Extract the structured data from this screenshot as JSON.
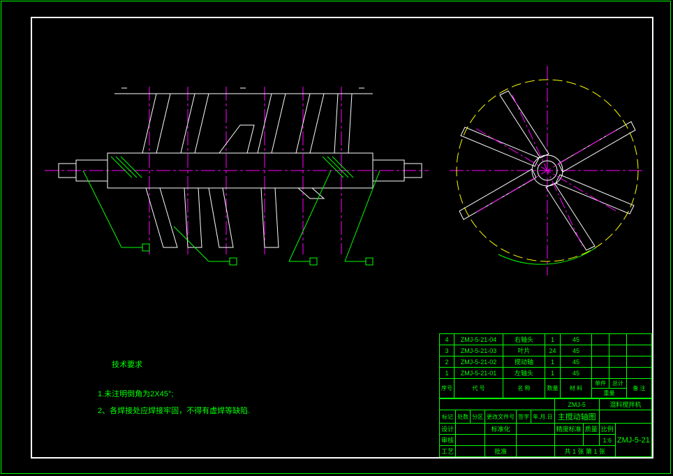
{
  "tech_req": {
    "title": "技术要求",
    "line1": "1.未注明倒角为2X45°;",
    "line2": "2、各焊接处应焊接牢固，不得有虚焊等缺陷."
  },
  "bom": [
    {
      "idx": "4",
      "code": "ZMJ-5-21-04",
      "name": "右轴头",
      "qty": "1",
      "mat": "45"
    },
    {
      "idx": "3",
      "code": "ZMJ-5-21-03",
      "name": "叶片",
      "qty": "24",
      "mat": "45"
    },
    {
      "idx": "2",
      "code": "ZMJ-5-21-02",
      "name": "搅动轴",
      "qty": "1",
      "mat": "45"
    },
    {
      "idx": "1",
      "code": "ZMJ-5-21-01",
      "name": "左轴头",
      "qty": "1",
      "mat": "45"
    }
  ],
  "bom_headers": {
    "idx": "序号",
    "code": "代 号",
    "name": "名 称",
    "qty": "数量",
    "mat": "材 料",
    "uw": "单件",
    "tw": "总计",
    "wt": "重量",
    "note": "备 注"
  },
  "title_info": {
    "proj_code": "ZMJ-5",
    "proj_name": "混料搅拌机",
    "drawing_title": "主搅动轴图",
    "tolerance": "精度标准",
    "scale_lbl": "比例",
    "mass_lbl": "质量",
    "scale_val": "1:6",
    "sheet": "共 1 张  第 1 张",
    "drawing_no": "ZMJ-5-21",
    "sig_a": "标记",
    "sig_b": "处数",
    "sig_c": "分区",
    "sig_d": "更改文件号",
    "sig_e": "签字",
    "sig_f": "年.月.日",
    "row1": "设计",
    "row1b": "标准化",
    "row2": "审核",
    "row3": "工艺",
    "row3b": "批准"
  }
}
